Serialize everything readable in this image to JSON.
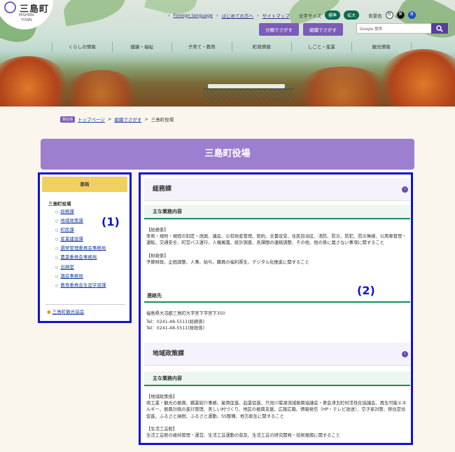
{
  "header": {
    "logo_text": "三島町",
    "logo_roman": "MISHIMA",
    "logo_roman2": "TOWN",
    "util_links": [
      "Foreign language",
      "はじめての方へ",
      "サイトマップ"
    ],
    "font_size_label": "文字サイズ",
    "font_standard": "標準",
    "font_large": "拡大",
    "bg_label": "背景色",
    "bg_white": "白",
    "bg_black": "黒",
    "bg_blue": "青",
    "search_by_category": "分類でさがす",
    "search_by_org": "組織でさがす",
    "search_placeholder": "Google 提供"
  },
  "nav": [
    "くらしの情報",
    "健康・福祉",
    "子育て・教育",
    "町政情報",
    "しごと・産業",
    "観光情報"
  ],
  "breadcrumb": {
    "badge": "現在地",
    "home": "トップページ",
    "org": "組織でさがす",
    "current": "三島町役場"
  },
  "page_title": "三島町役場",
  "sidebar": {
    "head": "部局",
    "org": "三島町役場",
    "items": [
      "総務課",
      "地域政策課",
      "町民課",
      "産業建設課",
      "選挙管理委員会事務局",
      "農業委員会事務局",
      "出納室",
      "議会事務局",
      "教育委員会生涯学習課"
    ],
    "tourism": "三島町観光協会",
    "callout": "(1)"
  },
  "main": {
    "callout": "(2)",
    "sec1": {
      "title": "総務課",
      "duties_h": "主な業務内容",
      "p1": "【総務係】",
      "p2": "条例・規則・規程の制定・改廃、議会、公有財産管理、契約、文書収受、住民自治区、消防、防災、防犯、防災無線、公用車管理・運転、交通安全、町営バス運行、人権擁護、統計調査、各課間の連絡調整、その他、他の係に属さない事項に関すること",
      "p3": "【財政係】",
      "p4": "予算財政、企画調整、人事、給与、職員の福利厚生、デジタル化推進に関すること",
      "contact_h": "連絡先",
      "addr": "福島県大沼郡三島町大字宮下字宮下350",
      "tel1": "Tel：0241-48-5511(総務係)",
      "tel2": "Tel：0241-48-5511(財政係)"
    },
    "sec2": {
      "title": "地域政策課",
      "duties_h": "主な業務内容",
      "p1": "【地域政策係】",
      "p2": "商工業・観光の振興、職業紹介事務、雇用促進、起業促進、只見川電源流域振興協議会・奥会津五町村活性化協議会、再生可能エネルギー、振興計画の進行管理、美しい村づくり、地区の振興支援、広報広聴、情報発信（HP・テレビ放送）、空き家対策、移住定住促進、ふるさと納税、ふるさと運動、SS整備、地方創生に関すること",
      "p3": "【生活工芸館】",
      "p4": "生活工芸館の維持管理・運営、生活工芸運動の普及、生活工芸の研究開発・技術振興に関すること"
    }
  }
}
